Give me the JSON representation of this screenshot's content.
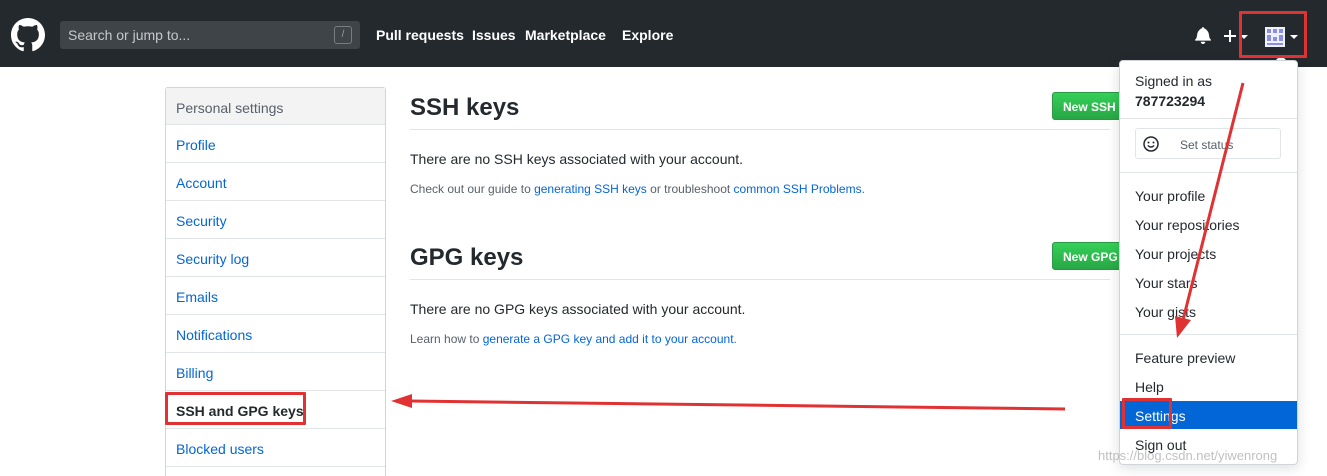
{
  "header": {
    "search_placeholder": "Search or jump to...",
    "search_shortcut": "/",
    "nav": [
      "Pull requests",
      "Issues",
      "Marketplace",
      "Explore"
    ]
  },
  "settings_menu": {
    "heading": "Personal settings",
    "items": [
      "Profile",
      "Account",
      "Security",
      "Security log",
      "Emails",
      "Notifications",
      "Billing",
      "SSH and GPG keys",
      "Blocked users"
    ],
    "selected": "SSH and GPG keys"
  },
  "ssh": {
    "title": "SSH keys",
    "button": "New SSH key",
    "empty": "There are no SSH keys associated with your account.",
    "help_prefix": "Check out our guide to ",
    "help_link1": "generating SSH keys",
    "help_middle": " or troubleshoot ",
    "help_link2": "common SSH Problems",
    "help_suffix": "."
  },
  "gpg": {
    "title": "GPG keys",
    "button": "New GPG key",
    "empty": "There are no GPG keys associated with your account.",
    "help_prefix": "Learn how to ",
    "help_link": "generate a GPG key and add it to your account",
    "help_suffix": "."
  },
  "dropdown": {
    "signed_in_as": "Signed in as",
    "username": "787723294",
    "set_status": "Set status",
    "items": [
      "Your profile",
      "Your repositories",
      "Your projects",
      "Your stars",
      "Your gists"
    ],
    "items2": [
      "Feature preview",
      "Help",
      "Settings",
      "Sign out"
    ],
    "active": "Settings"
  },
  "watermark": "https://blog.csdn.net/yiwenrong",
  "colors": {
    "header_bg": "#24292e",
    "link": "#0366d6",
    "button_green": "#28a745",
    "annotation_red": "#e03232",
    "active_item": "#0366d6"
  },
  "icons": [
    "github-logo-icon",
    "bell-icon",
    "plus-icon",
    "caret-down-icon",
    "smiley-icon",
    "avatar-icon"
  ]
}
